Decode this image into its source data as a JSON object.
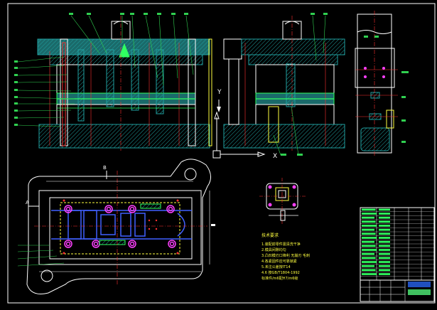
{
  "drawing": {
    "background": "#000000",
    "colors": {
      "frame": "#ffffff",
      "outline": "#ffffff",
      "centerline": "#ff3030",
      "hatch": "#20a0a0",
      "part_fill": "#1a6a6a",
      "green": "#30ff60",
      "yellow": "#ffff40",
      "magenta": "#ff40ff",
      "blue": "#4060ff",
      "leader": "#30d050"
    }
  },
  "views": {
    "front_label_a": "A",
    "front_label_b": "B",
    "axis_y": "Y",
    "axis_x": "X"
  },
  "plan_view": {
    "label_a": "A",
    "label_b": "B"
  },
  "notes": {
    "title": "技术要求",
    "lines": [
      "1.装配前零件需清洗干净",
      "2.模具间隙均匀",
      "3.凸凹模刃口锋利 无崩刃 毛刺",
      "4.各紧固件应可靠锁紧",
      "5.未注公差按IT14",
      "4.6 按GB/T1804-1992",
      "标准件/m6配H7/m6级"
    ]
  },
  "title_block": {
    "rows": 18
  }
}
